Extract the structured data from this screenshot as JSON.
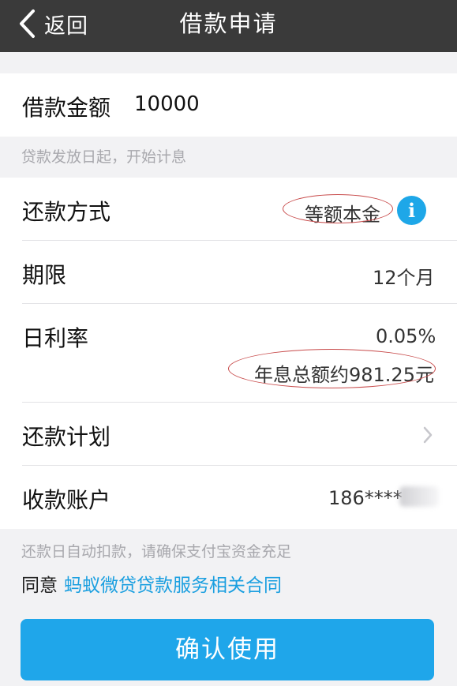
{
  "navbar": {
    "back_label": "返回",
    "title": "借款申请"
  },
  "loan": {
    "amount_label": "借款金额",
    "amount_value": "10000",
    "interest_hint": "贷款发放日起，开始计息"
  },
  "terms": {
    "repay_method_label": "还款方式",
    "repay_method_value": "等额本金",
    "term_label": "期限",
    "term_value": "12个月",
    "rate_label": "日利率",
    "rate_value": "0.05%",
    "annual_interest": "年息总额约981.25元",
    "plan_label": "还款计划",
    "account_label": "收款账户",
    "account_value": "186****"
  },
  "footer": {
    "auto_debit_hint": "还款日自动扣款，请确保支付宝资金充足",
    "agree_text": "同意",
    "contract_link": "蚂蚁微贷贷款服务相关合同",
    "confirm_button": "确认使用"
  },
  "colors": {
    "navbar_bg": "#3a3a3a",
    "accent_blue": "#1fa6ea",
    "annotation_red": "#c84b4b",
    "page_bg": "#f2f2f4"
  },
  "icons": {
    "back": "chevron-left-icon",
    "info": "info-icon",
    "plan_arrow": "chevron-right-icon"
  }
}
